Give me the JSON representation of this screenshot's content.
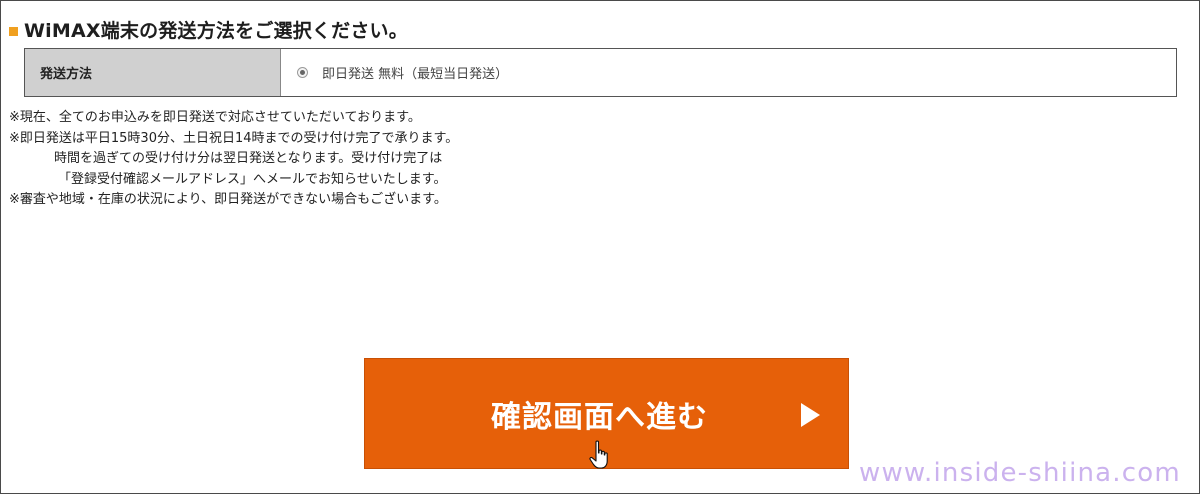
{
  "heading": {
    "title": "WiMAX端末の発送方法をご選択ください。",
    "marker_color": "#f0a020"
  },
  "shipping_method": {
    "label": "発送方法",
    "option_text": "即日発送 無料（最短当日発送）",
    "selected": true
  },
  "notes": [
    "※現在、全てのお申込みを即日発送で対応させていただいております。",
    "※即日発送は平日15時30分、土日祝日14時までの受け付け完了で承ります。",
    "時間を過ぎての受け付け分は翌日発送となります。受け付け完了は",
    "「登録受付確認メールアドレス」へメールでお知らせいたします。",
    "※審査や地域・在庫の状況により、即日発送ができない場合もございます。"
  ],
  "confirm_button": {
    "label": "確認画面へ進む",
    "icon": "play-triangle-icon",
    "color": "#e66009"
  },
  "watermark": {
    "text": "www.inside-shiina.com"
  }
}
